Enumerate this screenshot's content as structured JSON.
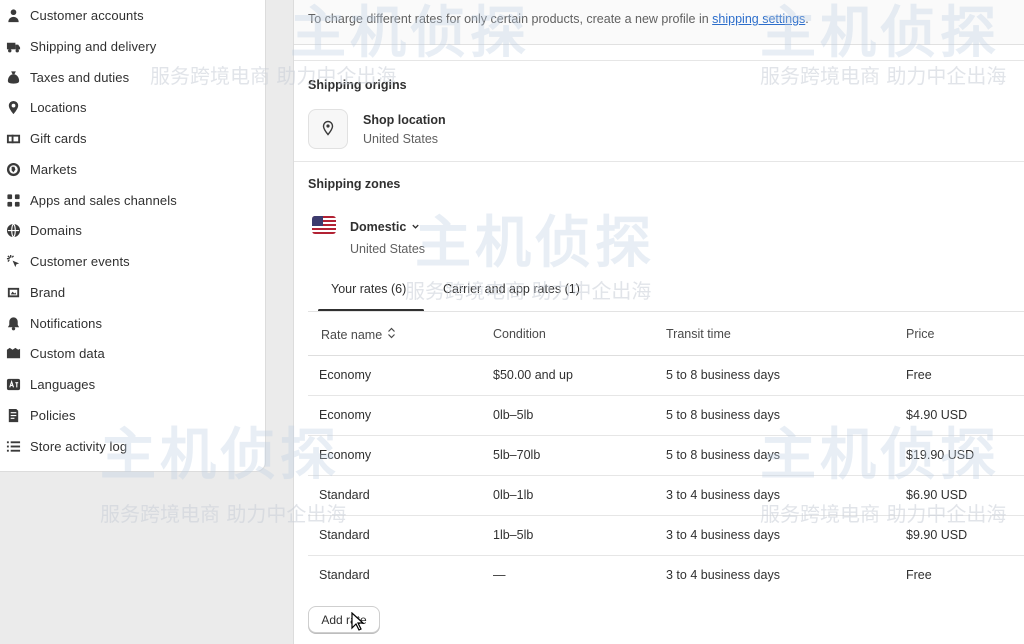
{
  "sidebar": {
    "items": [
      {
        "label": "Customer accounts",
        "icon": "person-icon"
      },
      {
        "label": "Shipping and delivery",
        "icon": "truck-icon"
      },
      {
        "label": "Taxes and duties",
        "icon": "money-bag-icon"
      },
      {
        "label": "Locations",
        "icon": "location-pin-icon"
      },
      {
        "label": "Gift cards",
        "icon": "gift-card-icon"
      },
      {
        "label": "Markets",
        "icon": "globe-markets-icon"
      },
      {
        "label": "Apps and sales channels",
        "icon": "apps-icon"
      },
      {
        "label": "Domains",
        "icon": "globe-icon"
      },
      {
        "label": "Customer events",
        "icon": "sparkle-cursor-icon"
      },
      {
        "label": "Brand",
        "icon": "brand-icon"
      },
      {
        "label": "Notifications",
        "icon": "bell-icon"
      },
      {
        "label": "Custom data",
        "icon": "folder-icon"
      },
      {
        "label": "Languages",
        "icon": "language-icon"
      },
      {
        "label": "Policies",
        "icon": "policy-icon"
      },
      {
        "label": "Store activity log",
        "icon": "list-icon"
      }
    ]
  },
  "banner": {
    "text": "To charge different rates for only certain products, create a new profile in ",
    "link": "shipping settings",
    "suffix": "."
  },
  "origins": {
    "title": "Shipping origins",
    "location_name": "Shop location",
    "location_country": "United States"
  },
  "zones": {
    "title": "Shipping zones",
    "zone_name": "Domestic",
    "zone_country": "United States",
    "tabs": [
      {
        "label": "Your rates (6)",
        "selected": true
      },
      {
        "label": "Carrier and app rates (1)",
        "selected": false
      }
    ]
  },
  "table": {
    "headers": {
      "rate_name": "Rate name",
      "condition": "Condition",
      "transit": "Transit time",
      "price": "Price"
    },
    "rows": [
      {
        "name": "Economy",
        "condition": "$50.00 and up",
        "transit": "5 to 8 business days",
        "price": "Free"
      },
      {
        "name": "Economy",
        "condition": "0lb–5lb",
        "transit": "5 to 8 business days",
        "price": "$4.90 USD"
      },
      {
        "name": "Economy",
        "condition": "5lb–70lb",
        "transit": "5 to 8 business days",
        "price": "$19.90 USD"
      },
      {
        "name": "Standard",
        "condition": "0lb–1lb",
        "transit": "3 to 4 business days",
        "price": "$6.90 USD"
      },
      {
        "name": "Standard",
        "condition": "1lb–5lb",
        "transit": "3 to 4 business days",
        "price": "$9.90 USD"
      },
      {
        "name": "Standard",
        "condition": "—",
        "transit": "3 to 4 business days",
        "price": "Free"
      }
    ]
  },
  "actions": {
    "add_rate": "Add rate"
  },
  "watermark": {
    "big": "主机侦探",
    "small": "服务跨境电商 助力中企出海"
  }
}
